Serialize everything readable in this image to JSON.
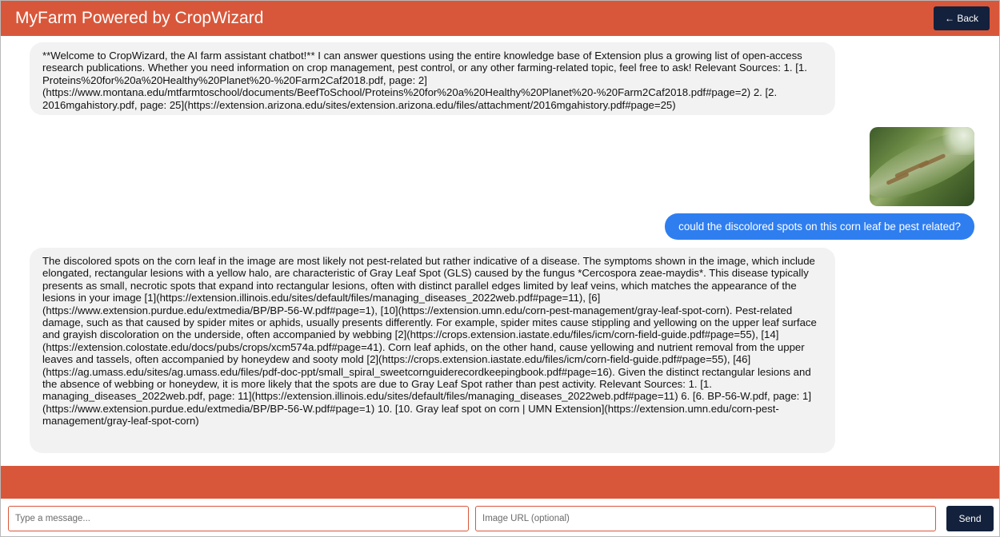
{
  "header": {
    "title": "MyFarm Powered by CropWizard",
    "back_label": "← Back"
  },
  "messages": [
    {
      "role": "assistant",
      "text": "**Welcome to CropWizard, the AI farm assistant chatbot!** I can answer questions using the entire knowledge base of Extension plus a growing list of open-access research publications. Whether you need information on crop management, pest control, or any other farming-related topic, feel free to ask! Relevant Sources: 1. [1. Proteins%20for%20a%20Healthy%20Planet%20-%20Farm2Caf2018.pdf, page: 2](https://www.montana.edu/mtfarmtoschool/documents/BeefToSchool/Proteins%20for%20a%20Healthy%20Planet%20-%20Farm2Caf2018.pdf#page=2) 2. [2. 2016mgahistory.pdf, page: 25](https://extension.arizona.edu/sites/extension.arizona.edu/files/attachment/2016mgahistory.pdf#page=25)"
    },
    {
      "role": "user",
      "image_alt": "corn-leaf-photo",
      "text": "could the discolored spots on this corn leaf be pest related?"
    },
    {
      "role": "assistant",
      "text": "The discolored spots on the corn leaf in the image are most likely not pest-related but rather indicative of a disease. The symptoms shown in the image, which include elongated, rectangular lesions with a yellow halo, are characteristic of Gray Leaf Spot (GLS) caused by the fungus *Cercospora zeae-maydis*. This disease typically presents as small, necrotic spots that expand into rectangular lesions, often with distinct parallel edges limited by leaf veins, which matches the appearance of the lesions in your image [1](https://extension.illinois.edu/sites/default/files/managing_diseases_2022web.pdf#page=11), [6](https://www.extension.purdue.edu/extmedia/BP/BP-56-W.pdf#page=1), [10](https://extension.umn.edu/corn-pest-management/gray-leaf-spot-corn). Pest-related damage, such as that caused by spider mites or aphids, usually presents differently. For example, spider mites cause stippling and yellowing on the upper leaf surface and grayish discoloration on the underside, often accompanied by webbing [2](https://crops.extension.iastate.edu/files/icm/corn-field-guide.pdf#page=55), [14](https://extension.colostate.edu/docs/pubs/crops/xcm574a.pdf#page=41). Corn leaf aphids, on the other hand, cause yellowing and nutrient removal from the upper leaves and tassels, often accompanied by honeydew and sooty mold [2](https://crops.extension.iastate.edu/files/icm/corn-field-guide.pdf#page=55), [46](https://ag.umass.edu/sites/ag.umass.edu/files/pdf-doc-ppt/small_spiral_sweetcornguiderecordkeepingbook.pdf#page=16). Given the distinct rectangular lesions and the absence of webbing or honeydew, it is more likely that the spots are due to Gray Leaf Spot rather than pest activity. Relevant Sources: 1. [1. managing_diseases_2022web.pdf, page: 11](https://extension.illinois.edu/sites/default/files/managing_diseases_2022web.pdf#page=11) 6. [6. BP-56-W.pdf, page: 1](https://www.extension.purdue.edu/extmedia/BP/BP-56-W.pdf#page=1) 10. [10. Gray leaf spot on corn | UMN Extension](https://extension.umn.edu/corn-pest-management/gray-leaf-spot-corn)"
    }
  ],
  "composer": {
    "message_placeholder": "Type a message...",
    "image_url_placeholder": "Image URL (optional)",
    "send_label": "Send"
  },
  "colors": {
    "brand": "#d8573a",
    "navy": "#13213c",
    "user_bubble": "#2f7ef0",
    "bot_bubble": "#f2f2f2"
  }
}
